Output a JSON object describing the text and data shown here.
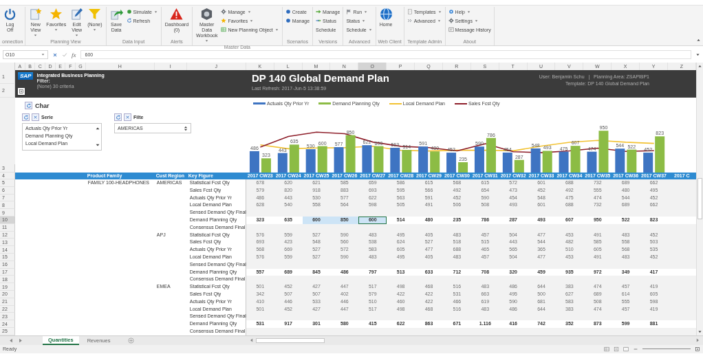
{
  "ribbon": {
    "groups": [
      {
        "label": "onnection",
        "items": [
          {
            "kind": "large",
            "label": "Log Off",
            "dropdown": false
          }
        ]
      },
      {
        "label": "Planning View",
        "items": [
          {
            "kind": "large",
            "label": "New View",
            "dropdown": true
          },
          {
            "kind": "large",
            "label": "Favorites",
            "dropdown": true
          },
          {
            "kind": "large",
            "label": "Edit View",
            "dropdown": true
          },
          {
            "kind": "large",
            "label": "(None)",
            "dropdown": true
          }
        ]
      },
      {
        "label": "Data Input",
        "items": [
          {
            "kind": "large",
            "label": "Save Data",
            "dropdown": false
          },
          {
            "kind": "stack",
            "items": [
              {
                "label": "Simulate",
                "dropdown": true
              },
              {
                "label": "Refresh",
                "dropdown": false
              }
            ]
          }
        ]
      },
      {
        "label": "Alerts",
        "items": [
          {
            "kind": "large",
            "label": "Dashboard (0)",
            "dropdown": false
          }
        ]
      },
      {
        "label": "Master Data",
        "items": [
          {
            "kind": "large",
            "label": "Master Data Workbook",
            "dropdown": true
          },
          {
            "kind": "stack",
            "items": [
              {
                "label": "Manage",
                "dropdown": true
              },
              {
                "label": "Favorites",
                "dropdown": true
              },
              {
                "label": "New Planning Object",
                "dropdown": true
              }
            ]
          }
        ]
      },
      {
        "label": "Scenarios",
        "items": [
          {
            "kind": "stack",
            "items": [
              {
                "label": "Create",
                "dropdown": false
              },
              {
                "label": "Manage",
                "dropdown": false
              }
            ]
          }
        ]
      },
      {
        "label": "Versions",
        "items": [
          {
            "kind": "stack",
            "items": [
              {
                "label": "Manage",
                "dropdown": false
              },
              {
                "label": "Status",
                "dropdown": false
              },
              {
                "label": "Schedule",
                "dropdown": false
              }
            ]
          }
        ]
      },
      {
        "label": "Advanced",
        "items": [
          {
            "kind": "stack",
            "items": [
              {
                "label": "Run",
                "dropdown": true
              },
              {
                "label": "Status",
                "dropdown": true
              },
              {
                "label": "Schedule",
                "dropdown": true
              }
            ]
          }
        ]
      },
      {
        "label": "Web Client",
        "items": [
          {
            "kind": "large",
            "label": "Home",
            "dropdown": false
          }
        ]
      },
      {
        "label": "Template Admin",
        "items": [
          {
            "kind": "stack",
            "items": [
              {
                "label": "Templates",
                "dropdown": true
              },
              {
                "label": "Advanced",
                "dropdown": true
              }
            ]
          }
        ]
      },
      {
        "label": "About",
        "items": [
          {
            "kind": "stack",
            "items": [
              {
                "label": "Help",
                "dropdown": true
              },
              {
                "label": "Settings",
                "dropdown": true
              },
              {
                "label": "Message History",
                "dropdown": false
              }
            ]
          }
        ]
      }
    ]
  },
  "formula_bar": {
    "cell_ref": "O10",
    "function_label": "fx",
    "value": "600"
  },
  "sheet": {
    "columns": [
      {
        "letter": "A",
        "selected": false
      },
      {
        "letter": "B",
        "selected": false
      },
      {
        "letter": "C",
        "selected": false
      },
      {
        "letter": "D",
        "selected": false
      },
      {
        "letter": "E",
        "selected": false
      },
      {
        "letter": "F",
        "selected": false
      },
      {
        "letter": "G",
        "selected": false
      },
      {
        "letter": "H",
        "selected": false
      },
      {
        "letter": "I",
        "selected": false
      },
      {
        "letter": "J",
        "selected": false
      },
      {
        "letter": "K",
        "selected": false
      },
      {
        "letter": "L",
        "selected": false
      },
      {
        "letter": "M",
        "selected": false
      },
      {
        "letter": "N",
        "selected": false
      },
      {
        "letter": "O",
        "selected": true
      },
      {
        "letter": "P",
        "selected": false
      },
      {
        "letter": "Q",
        "selected": false
      },
      {
        "letter": "R",
        "selected": false
      },
      {
        "letter": "S",
        "selected": false
      },
      {
        "letter": "T",
        "selected": false
      },
      {
        "letter": "U",
        "selected": false
      },
      {
        "letter": "V",
        "selected": false
      },
      {
        "letter": "W",
        "selected": false
      },
      {
        "letter": "X",
        "selected": false
      },
      {
        "letter": "Y",
        "selected": false
      },
      {
        "letter": "Z",
        "selected": false
      }
    ],
    "row_numbers": [
      {
        "n": "1",
        "selected": false
      },
      {
        "n": "2",
        "selected": false
      },
      {
        "n": "3",
        "selected": false
      },
      {
        "n": "4",
        "selected": false
      },
      {
        "n": "5",
        "selected": false
      },
      {
        "n": "6",
        "selected": false
      },
      {
        "n": "7",
        "selected": false
      },
      {
        "n": "8",
        "selected": false
      },
      {
        "n": "9",
        "selected": false
      },
      {
        "n": "10",
        "selected": true
      },
      {
        "n": "11",
        "selected": false
      },
      {
        "n": "12",
        "selected": false
      },
      {
        "n": "13",
        "selected": false
      },
      {
        "n": "14",
        "selected": false
      },
      {
        "n": "15",
        "selected": false
      },
      {
        "n": "16",
        "selected": false
      },
      {
        "n": "17",
        "selected": false
      },
      {
        "n": "18",
        "selected": false
      },
      {
        "n": "19",
        "selected": false
      },
      {
        "n": "20",
        "selected": false
      },
      {
        "n": "21",
        "selected": false
      },
      {
        "n": "22",
        "selected": false
      },
      {
        "n": "23",
        "selected": false
      },
      {
        "n": "24",
        "selected": false
      },
      {
        "n": "25",
        "selected": false
      }
    ]
  },
  "sap_header": {
    "logo": "SAP",
    "app_title": "Integrated Business Planning",
    "filter_label": "Filter:",
    "filter_value": "(None) 30 criteria"
  },
  "report_header": {
    "title": "DP 140 Global Demand Plan",
    "last_refresh": "Last Refresh: 2017-Jun-5  13:38:59",
    "user_info": "User: Benjamin Schu   |   Planning Area: ZSAPIBP1",
    "template": "Template: DP 140 Global Demand Plan"
  },
  "controls": {
    "char_label": "Char",
    "serie": {
      "label": "Serie",
      "items": [
        "Actuals Qty  Prior Yr",
        "Demand Planning Qty",
        "Local Demand Plan"
      ]
    },
    "filter": {
      "label": "Filte",
      "value": "AMERICAS"
    }
  },
  "chart": {
    "legend": [
      {
        "name": "Actuals Qty  Prior Yr",
        "color": "#3e74c2"
      },
      {
        "name": "Demand Planning Qty",
        "color": "#8cbc45"
      },
      {
        "name": "Local Demand Plan",
        "color": "#f2c232"
      },
      {
        "name": "Sales Fcst Qty",
        "color": "#8e1f2a"
      }
    ],
    "bars": [
      {
        "actual": "486",
        "planned": "323"
      },
      {
        "actual": "443",
        "planned": "635"
      },
      {
        "actual": "530",
        "planned": "600"
      },
      {
        "actual": "577",
        "planned": "850"
      },
      {
        "actual": "622",
        "planned": "600"
      },
      {
        "actual": "563",
        "planned": "514"
      },
      {
        "actual": "591",
        "planned": "480"
      },
      {
        "actual": "452",
        "planned": "235"
      },
      {
        "actual": "590",
        "planned": "786"
      },
      {
        "actual": "454",
        "planned": "287"
      },
      {
        "actual": "548",
        "planned": "493"
      },
      {
        "actual": "475",
        "planned": "607"
      },
      {
        "actual": "474",
        "planned": "950"
      },
      {
        "actual": "544",
        "planned": "522"
      },
      {
        "actual": "452",
        "planned": "823"
      }
    ]
  },
  "table": {
    "headers": [
      "Product Family",
      "Cust Region",
      "Key Figure"
    ],
    "periods": [
      "2017 CW23",
      "2017 CW24",
      "2017 CW25",
      "2017 CW26",
      "2017 CW27",
      "2017 CW28",
      "2017 CW29",
      "2017 CW30",
      "2017 CW31",
      "2017 CW32",
      "2017 CW33",
      "2017 CW34",
      "2017 CW35",
      "2017 CW36",
      "2017 CW37",
      "2017 C"
    ],
    "rows": [
      {
        "kind": "figure",
        "product_family": "FAMILY 100-HEADPHONES",
        "region": "AMERICAS",
        "key_figure": "Statistical Fcst Qty",
        "values": [
          "678",
          "620",
          "621",
          "585",
          "659",
          "586",
          "615",
          "568",
          "615",
          "572",
          "601",
          "688",
          "732",
          "689",
          "662"
        ]
      },
      {
        "kind": "figure",
        "key_figure": "Sales Fcst Qty",
        "values": [
          "579",
          "820",
          "918",
          "883",
          "693",
          "595",
          "566",
          "492",
          "654",
          "473",
          "452",
          "492",
          "555",
          "480",
          "495"
        ]
      },
      {
        "kind": "figure",
        "key_figure": "Actuals Qty  Prior Yr",
        "values": [
          "486",
          "443",
          "530",
          "577",
          "622",
          "563",
          "591",
          "452",
          "590",
          "454",
          "548",
          "475",
          "474",
          "544",
          "452"
        ]
      },
      {
        "kind": "figure",
        "key_figure": "Local Demand Plan",
        "values": [
          "628",
          "540",
          "558",
          "564",
          "598",
          "505",
          "491",
          "506",
          "508",
          "493",
          "601",
          "688",
          "732",
          "689",
          "662"
        ]
      },
      {
        "kind": "empty",
        "key_figure": "Sensed Demand Qty Final"
      },
      {
        "kind": "planning",
        "key_figure": "Demand Planning Qty",
        "cells": [
          {
            "value": "323",
            "selected": false,
            "active": false
          },
          {
            "value": "635",
            "selected": false,
            "active": false
          },
          {
            "value": "600",
            "selected": true,
            "active": false
          },
          {
            "value": "850",
            "selected": true,
            "active": false
          },
          {
            "value": "600",
            "selected": true,
            "active": true
          },
          {
            "value": "514",
            "selected": false,
            "active": false
          },
          {
            "value": "480",
            "selected": false,
            "active": false
          },
          {
            "value": "235",
            "selected": false,
            "active": false
          },
          {
            "value": "786",
            "selected": false,
            "active": false
          },
          {
            "value": "287",
            "selected": false,
            "active": false
          },
          {
            "value": "493",
            "selected": false,
            "active": false
          },
          {
            "value": "607",
            "selected": false,
            "active": false
          },
          {
            "value": "950",
            "selected": false,
            "active": false
          },
          {
            "value": "522",
            "selected": false,
            "active": false
          },
          {
            "value": "823",
            "selected": false,
            "active": false
          }
        ]
      },
      {
        "kind": "empty",
        "key_figure": "Consensus Demand Final"
      },
      {
        "kind": "figure",
        "region": "APJ",
        "key_figure": "Statistical Fcst Qty",
        "values": [
          "576",
          "559",
          "527",
          "590",
          "483",
          "495",
          "405",
          "483",
          "457",
          "504",
          "477",
          "453",
          "491",
          "483",
          "452"
        ]
      },
      {
        "kind": "figure",
        "key_figure": "Sales Fcst Qty",
        "values": [
          "693",
          "423",
          "548",
          "560",
          "538",
          "624",
          "527",
          "518",
          "515",
          "443",
          "544",
          "482",
          "585",
          "558",
          "503"
        ]
      },
      {
        "kind": "figure",
        "key_figure": "Actuals Qty  Prior Yr",
        "values": [
          "568",
          "669",
          "527",
          "572",
          "583",
          "605",
          "477",
          "688",
          "465",
          "565",
          "365",
          "510",
          "605",
          "568",
          "535"
        ]
      },
      {
        "kind": "figure",
        "key_figure": "Local Demand Plan",
        "values": [
          "576",
          "559",
          "527",
          "590",
          "483",
          "495",
          "405",
          "483",
          "457",
          "504",
          "477",
          "453",
          "491",
          "483",
          "452"
        ]
      },
      {
        "kind": "empty",
        "key_figure": "Sensed Demand Qty Final"
      },
      {
        "kind": "planning",
        "key_figure": "Demand Planning Qty",
        "cells": [
          {
            "value": "557",
            "selected": false,
            "active": false
          },
          {
            "value": "689",
            "selected": false,
            "active": false
          },
          {
            "value": "845",
            "selected": false,
            "active": false
          },
          {
            "value": "486",
            "selected": false,
            "active": false
          },
          {
            "value": "797",
            "selected": false,
            "active": false
          },
          {
            "value": "513",
            "selected": false,
            "active": false
          },
          {
            "value": "633",
            "selected": false,
            "active": false
          },
          {
            "value": "712",
            "selected": false,
            "active": false
          },
          {
            "value": "708",
            "selected": false,
            "active": false
          },
          {
            "value": "320",
            "selected": false,
            "active": false
          },
          {
            "value": "459",
            "selected": false,
            "active": false
          },
          {
            "value": "935",
            "selected": false,
            "active": false
          },
          {
            "value": "972",
            "selected": false,
            "active": false
          },
          {
            "value": "349",
            "selected": false,
            "active": false
          },
          {
            "value": "417",
            "selected": false,
            "active": false
          }
        ]
      },
      {
        "kind": "empty",
        "key_figure": "Consensus Demand Final"
      },
      {
        "kind": "figure",
        "region": "EMEA",
        "key_figure": "Statistical Fcst Qty",
        "values": [
          "501",
          "452",
          "427",
          "447",
          "517",
          "498",
          "468",
          "516",
          "483",
          "486",
          "644",
          "383",
          "474",
          "457",
          "419"
        ]
      },
      {
        "kind": "figure",
        "key_figure": "Sales Fcst Qty",
        "values": [
          "342",
          "507",
          "507",
          "402",
          "579",
          "422",
          "422",
          "531",
          "663",
          "495",
          "500",
          "627",
          "689",
          "614",
          "605"
        ]
      },
      {
        "kind": "figure",
        "key_figure": "Actuals Qty  Prior Yr",
        "values": [
          "410",
          "446",
          "533",
          "446",
          "510",
          "460",
          "422",
          "466",
          "619",
          "590",
          "681",
          "583",
          "508",
          "555",
          "598"
        ]
      },
      {
        "kind": "figure",
        "key_figure": "Local Demand Plan",
        "values": [
          "501",
          "452",
          "427",
          "447",
          "517",
          "498",
          "468",
          "516",
          "483",
          "486",
          "644",
          "383",
          "474",
          "457",
          "419"
        ]
      },
      {
        "kind": "empty",
        "key_figure": "Sensed Demand Qty Final"
      },
      {
        "kind": "planning",
        "key_figure": "Demand Planning Qty",
        "cells": [
          {
            "value": "531",
            "selected": false,
            "active": false
          },
          {
            "value": "917",
            "selected": false,
            "active": false
          },
          {
            "value": "301",
            "selected": false,
            "active": false
          },
          {
            "value": "580",
            "selected": false,
            "active": false
          },
          {
            "value": "415",
            "selected": false,
            "active": false
          },
          {
            "value": "622",
            "selected": false,
            "active": false
          },
          {
            "value": "863",
            "selected": false,
            "active": false
          },
          {
            "value": "671",
            "selected": false,
            "active": false
          },
          {
            "value": "1.116",
            "selected": false,
            "active": false
          },
          {
            "value": "416",
            "selected": false,
            "active": false
          },
          {
            "value": "742",
            "selected": false,
            "active": false
          },
          {
            "value": "352",
            "selected": false,
            "active": false
          },
          {
            "value": "873",
            "selected": false,
            "active": false
          },
          {
            "value": "599",
            "selected": false,
            "active": false
          },
          {
            "value": "881",
            "selected": false,
            "active": false
          }
        ]
      },
      {
        "kind": "empty",
        "key_figure": "Consensus Demand Final"
      }
    ]
  },
  "sheet_tabs": [
    {
      "label": "Quantities",
      "selected": true
    },
    {
      "label": "Revenues",
      "selected": false
    }
  ],
  "status_bar": {
    "text": "Ready"
  }
}
